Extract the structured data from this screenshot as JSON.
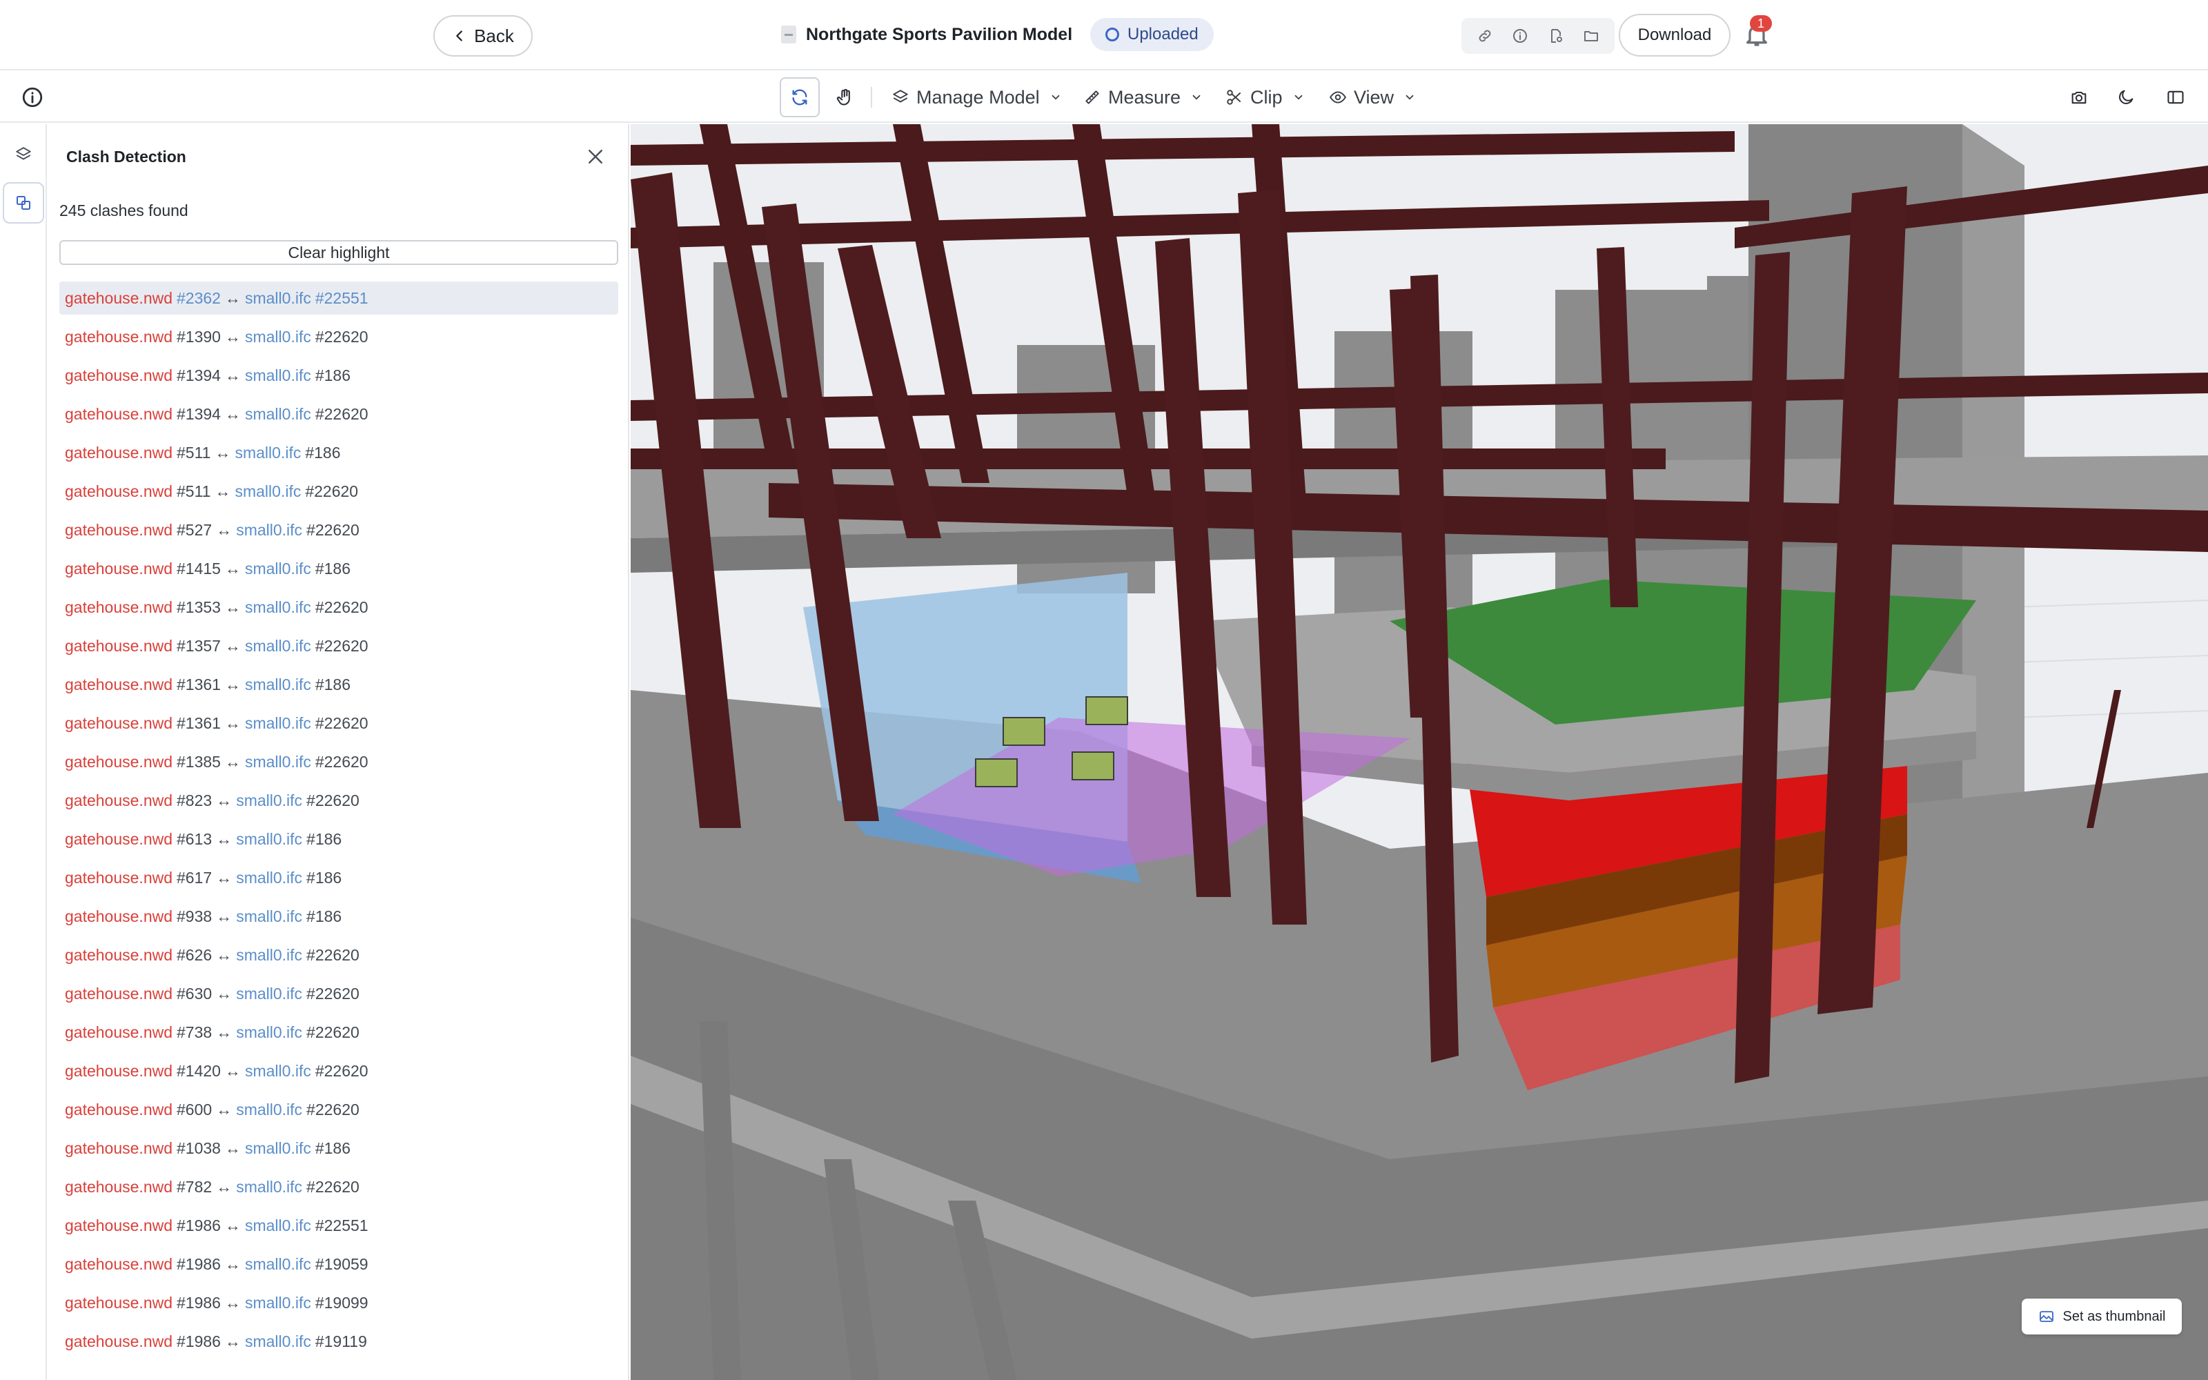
{
  "header": {
    "back_label": "Back",
    "title": "Northgate Sports Pavilion Model",
    "status": "Uploaded",
    "download_label": "Download",
    "notifications_count": "1",
    "icons": [
      "link-icon",
      "info-icon",
      "file-settings-icon",
      "folder-icon"
    ]
  },
  "toolbar": {
    "menus": [
      {
        "label": "Manage Model",
        "icon": "layers-icon"
      },
      {
        "label": "Measure",
        "icon": "ruler-icon"
      },
      {
        "label": "Clip",
        "icon": "scissors-icon"
      },
      {
        "label": "View",
        "icon": "eye-icon"
      }
    ],
    "right_icons": [
      "camera-icon",
      "moon-icon",
      "sidebar-icon"
    ]
  },
  "panel": {
    "title": "Clash Detection",
    "count_text": "245 clashes found",
    "clear_label": "Clear highlight",
    "clashes": [
      {
        "a": "gatehouse.nwd",
        "a_id": "#2362",
        "b": "small0.ifc",
        "b_id": "#22551",
        "selected": true
      },
      {
        "a": "gatehouse.nwd",
        "a_id": "#1390",
        "b": "small0.ifc",
        "b_id": "#22620"
      },
      {
        "a": "gatehouse.nwd",
        "a_id": "#1394",
        "b": "small0.ifc",
        "b_id": "#186"
      },
      {
        "a": "gatehouse.nwd",
        "a_id": "#1394",
        "b": "small0.ifc",
        "b_id": "#22620"
      },
      {
        "a": "gatehouse.nwd",
        "a_id": "#511",
        "b": "small0.ifc",
        "b_id": "#186"
      },
      {
        "a": "gatehouse.nwd",
        "a_id": "#511",
        "b": "small0.ifc",
        "b_id": "#22620"
      },
      {
        "a": "gatehouse.nwd",
        "a_id": "#527",
        "b": "small0.ifc",
        "b_id": "#22620"
      },
      {
        "a": "gatehouse.nwd",
        "a_id": "#1415",
        "b": "small0.ifc",
        "b_id": "#186"
      },
      {
        "a": "gatehouse.nwd",
        "a_id": "#1353",
        "b": "small0.ifc",
        "b_id": "#22620"
      },
      {
        "a": "gatehouse.nwd",
        "a_id": "#1357",
        "b": "small0.ifc",
        "b_id": "#22620"
      },
      {
        "a": "gatehouse.nwd",
        "a_id": "#1361",
        "b": "small0.ifc",
        "b_id": "#186"
      },
      {
        "a": "gatehouse.nwd",
        "a_id": "#1361",
        "b": "small0.ifc",
        "b_id": "#22620"
      },
      {
        "a": "gatehouse.nwd",
        "a_id": "#1385",
        "b": "small0.ifc",
        "b_id": "#22620"
      },
      {
        "a": "gatehouse.nwd",
        "a_id": "#823",
        "b": "small0.ifc",
        "b_id": "#22620"
      },
      {
        "a": "gatehouse.nwd",
        "a_id": "#613",
        "b": "small0.ifc",
        "b_id": "#186"
      },
      {
        "a": "gatehouse.nwd",
        "a_id": "#617",
        "b": "small0.ifc",
        "b_id": "#186"
      },
      {
        "a": "gatehouse.nwd",
        "a_id": "#938",
        "b": "small0.ifc",
        "b_id": "#186"
      },
      {
        "a": "gatehouse.nwd",
        "a_id": "#626",
        "b": "small0.ifc",
        "b_id": "#22620"
      },
      {
        "a": "gatehouse.nwd",
        "a_id": "#630",
        "b": "small0.ifc",
        "b_id": "#22620"
      },
      {
        "a": "gatehouse.nwd",
        "a_id": "#738",
        "b": "small0.ifc",
        "b_id": "#22620"
      },
      {
        "a": "gatehouse.nwd",
        "a_id": "#1420",
        "b": "small0.ifc",
        "b_id": "#22620"
      },
      {
        "a": "gatehouse.nwd",
        "a_id": "#600",
        "b": "small0.ifc",
        "b_id": "#22620"
      },
      {
        "a": "gatehouse.nwd",
        "a_id": "#1038",
        "b": "small0.ifc",
        "b_id": "#186"
      },
      {
        "a": "gatehouse.nwd",
        "a_id": "#782",
        "b": "small0.ifc",
        "b_id": "#22620"
      },
      {
        "a": "gatehouse.nwd",
        "a_id": "#1986",
        "b": "small0.ifc",
        "b_id": "#22551"
      },
      {
        "a": "gatehouse.nwd",
        "a_id": "#1986",
        "b": "small0.ifc",
        "b_id": "#19059"
      },
      {
        "a": "gatehouse.nwd",
        "a_id": "#1986",
        "b": "small0.ifc",
        "b_id": "#19099"
      },
      {
        "a": "gatehouse.nwd",
        "a_id": "#1986",
        "b": "small0.ifc",
        "b_id": "#19119"
      }
    ]
  },
  "viewport": {
    "thumbnail_label": "Set as thumbnail",
    "colors": {
      "steel": "#4a1a1c",
      "slab": "#8a8a8a",
      "roof": "#3a8a3a",
      "clash_red": "#e01010",
      "orange": "#8a4a0a",
      "glass": "#7fb0d8",
      "highlight": "#c070e0"
    }
  },
  "arrow": "↔"
}
